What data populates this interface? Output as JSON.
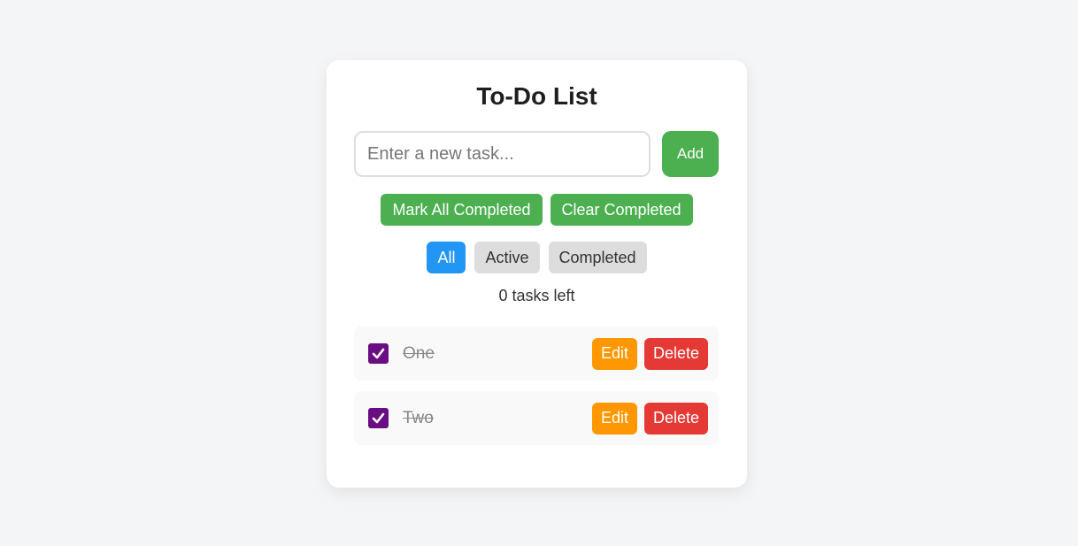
{
  "app": {
    "title": "To-Do List"
  },
  "input": {
    "placeholder": "Enter a new task...",
    "value": ""
  },
  "add_button": {
    "label": "Add"
  },
  "bulk_actions": {
    "mark_all_label": "Mark All Completed",
    "clear_completed_label": "Clear Completed"
  },
  "filters": {
    "selected": "All",
    "items": [
      {
        "label": "All",
        "active": true
      },
      {
        "label": "Active",
        "active": false
      },
      {
        "label": "Completed",
        "active": false
      }
    ]
  },
  "status": {
    "tasks_left": "0 tasks left"
  },
  "tasks": [
    {
      "text": "One",
      "completed": true,
      "edit_label": "Edit",
      "delete_label": "Delete"
    },
    {
      "text": "Two",
      "completed": true,
      "edit_label": "Edit",
      "delete_label": "Delete"
    }
  ],
  "colors": {
    "background": "#f4f5f7",
    "primary_green": "#4caf50",
    "active_blue": "#2196f3",
    "filter_gray": "#dddddd",
    "edit_orange": "#ff9800",
    "delete_red": "#e53935",
    "checkbox_purple": "#6a0d83"
  },
  "icons": {
    "checkbox_checked": "checkmark-icon"
  }
}
